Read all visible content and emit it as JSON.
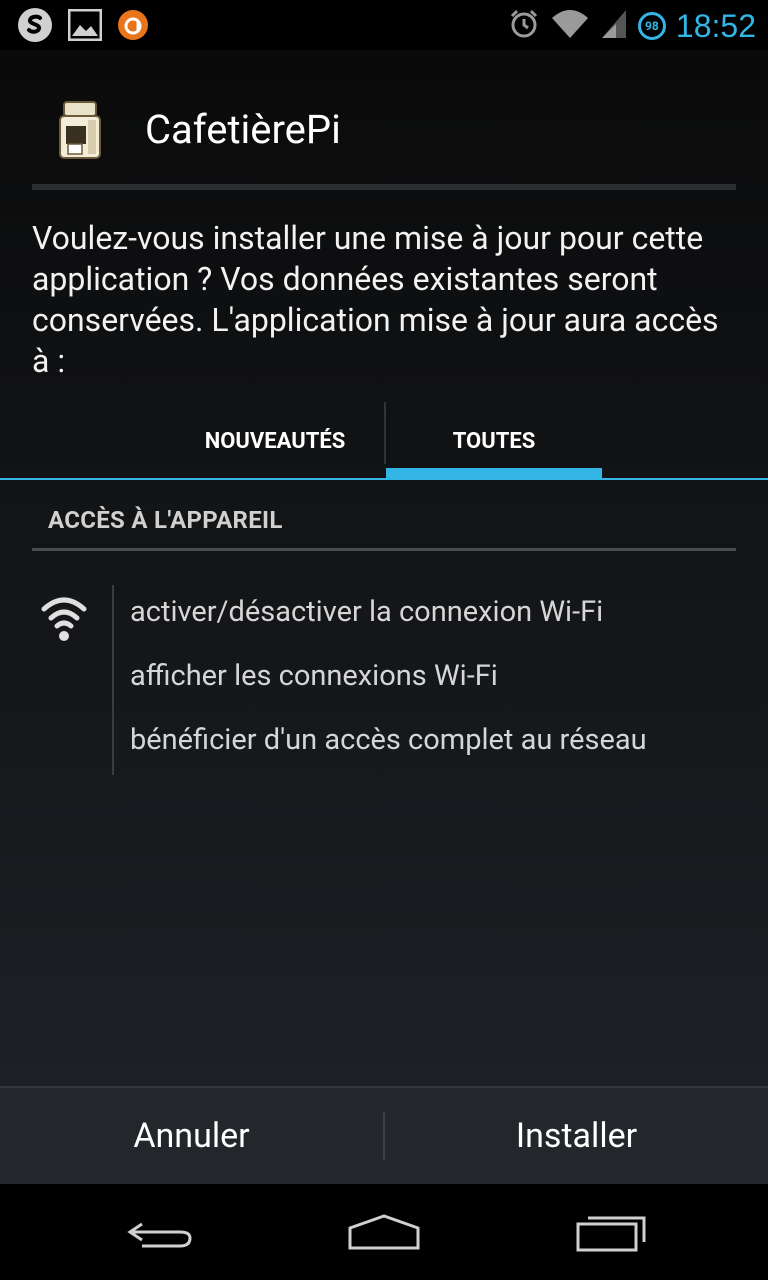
{
  "status_bar": {
    "time": "18:52",
    "battery_level": "98",
    "icons": [
      "skype-icon",
      "gallery-icon",
      "avast-icon",
      "alarm-icon",
      "wifi-icon",
      "signal-icon",
      "battery-icon"
    ]
  },
  "app": {
    "name": "CafetièrePi",
    "icon": "coffee-maker-icon"
  },
  "intro_text": "Voulez-vous installer une mise à jour pour cette application ? Vos données existantes seront conservées. L'application mise à jour aura accès à :",
  "tabs": [
    {
      "label": "NOUVEAUTÉS",
      "selected": false
    },
    {
      "label": "TOUTES",
      "selected": true
    }
  ],
  "section": {
    "title": "ACCÈS À L'APPAREIL",
    "icon": "wifi-icon",
    "permissions": [
      "activer/désactiver la connexion Wi-Fi",
      "afficher les connexions Wi-Fi",
      "bénéficier d'un accès complet au réseau"
    ]
  },
  "buttons": {
    "cancel": "Annuler",
    "install": "Installer"
  },
  "nav": [
    "back-icon",
    "home-icon",
    "recents-icon"
  ],
  "colors": {
    "accent": "#33b5e5",
    "background": "#000000"
  }
}
